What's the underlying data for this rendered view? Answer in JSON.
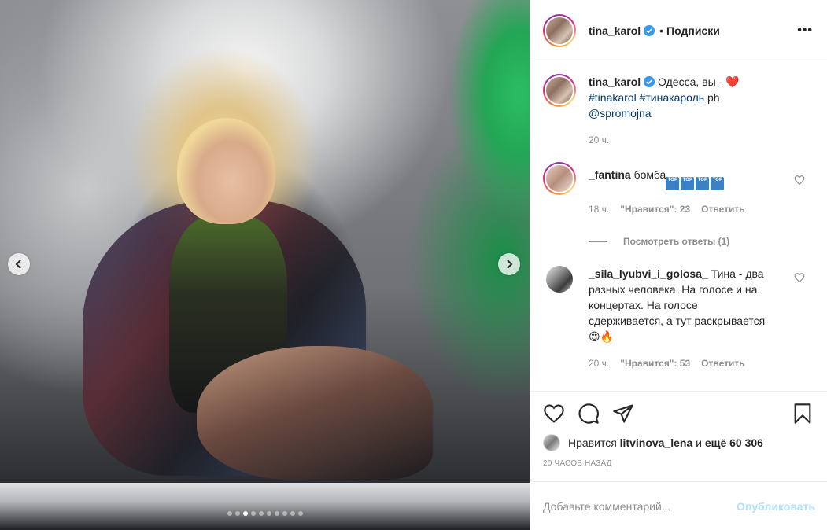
{
  "post": {
    "author": "tina_karol",
    "follow_separator": "•",
    "follow_label": "Подписки",
    "more_label": "•••"
  },
  "media": {
    "slide_count": 10,
    "active_slide": 3
  },
  "caption": {
    "author": "tina_karol",
    "text": "Одесса, вы -",
    "emoji": "❤️",
    "hashtag_1": "#tinakarol",
    "hashtag_2": "#тинакароль",
    "ph": "ph",
    "mention": "@spromojna",
    "time": "20 ч."
  },
  "comments": [
    {
      "author": "_fantina",
      "text": "бомба",
      "badges": [
        "TOP",
        "TOP",
        "TOP",
        "TOP"
      ],
      "time": "18 ч.",
      "likes": "\"Нравится\": 23",
      "reply": "Ответить",
      "view_replies": "Посмотреть ответы (1)"
    },
    {
      "author": "_sila_lyubvi_i_golosa_",
      "text": "Тина - два разных человека. На голосе и на концертах. На голосе сдерживается, а тут раскрывается",
      "emoji": "😍🔥",
      "time": "20 ч.",
      "likes": "\"Нравится\": 53",
      "reply": "Ответить"
    }
  ],
  "likes": {
    "prefix": "Нравится",
    "user": "litvinova_lena",
    "middle": "и",
    "rest": "ещё 60 306"
  },
  "posted_ago": "20 часов назад",
  "add_comment": {
    "placeholder": "Добавьте комментарий...",
    "publish": "Опубликовать"
  },
  "colors": {
    "link": "#00376b",
    "muted": "#8e8e8e",
    "verified": "#3897f0",
    "publish_disabled": "#b2dffc"
  }
}
